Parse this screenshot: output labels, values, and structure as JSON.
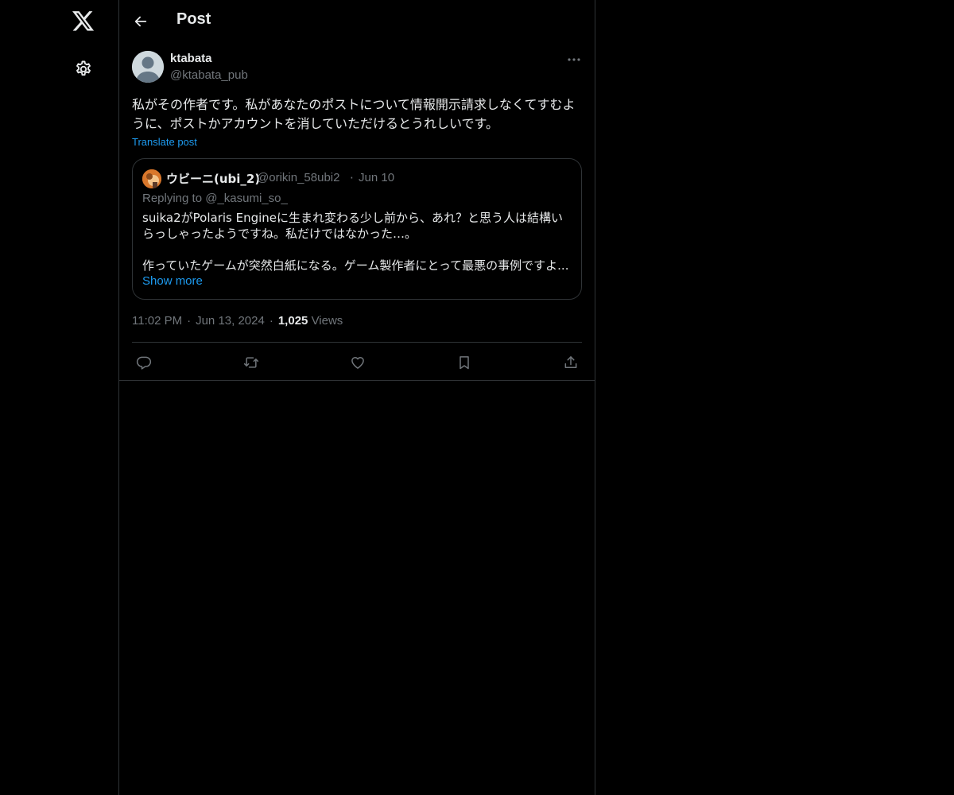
{
  "nav": {
    "logo_icon": "x-logo-icon",
    "settings_icon": "gear-icon"
  },
  "header": {
    "title": "Post",
    "back_icon": "arrow-left-icon"
  },
  "post": {
    "author_name": "ktabata",
    "author_handle": "@ktabata_pub",
    "text": "私がその作者です。私があなたのポストについて情報開示請求しなくてすむように、ポストかアカウントを消していただけるとうれしいです。",
    "translate_label": "Translate post",
    "time": "11:02 PM",
    "date": "Jun 13, 2024",
    "views_count": "1,025",
    "views_label": "Views",
    "meta_separator": "·"
  },
  "quote": {
    "name": "ウビーニ(ubi_2)",
    "handle": "@orikin_58ubi2",
    "date": "Jun 10",
    "separator": "·",
    "replying_to": "Replying to @_kasumi_so_",
    "text_p1": "suika2がPolaris Engineに生まれ変わる少し前から、あれ？と思う人は結構いらっしゃったようですね。私だけではなかった…。",
    "text_p2": "作っていたゲームが突然白紙になる。ゲーム製作者にとって最悪の事例ですよ...",
    "show_more": "Show more"
  },
  "actions": [
    "reply-icon",
    "repost-icon",
    "like-icon",
    "bookmark-icon",
    "share-icon"
  ],
  "colors": {
    "background": "#000000",
    "text": "#e7e9ea",
    "secondary_text": "#71767b",
    "accent": "#1d9bf0",
    "border": "#2f3336"
  }
}
